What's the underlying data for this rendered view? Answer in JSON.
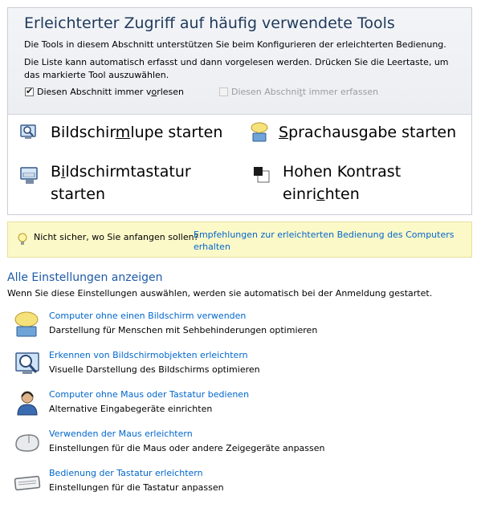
{
  "quick_access": {
    "title": "Erleichterter Zugriff auf häufig verwendete Tools",
    "description1": "Die Tools in diesem Abschnitt unterstützen Sie beim Konfigurieren der erleichterten Bedienung.",
    "description2": "Die Liste kann automatisch erfasst und dann vorgelesen werden. Drücken Sie die Leertaste, um das markierte Tool auszuwählen.",
    "checkbox_read": {
      "label_pre": "Diesen Abschnitt immer v",
      "label_u": "o",
      "label_post": "rlesen",
      "checked": true
    },
    "checkbox_scan": {
      "label_pre": "Diesen Abschni",
      "label_u": "t",
      "label_post": "t immer erfassen",
      "checked": false,
      "disabled": true
    },
    "tools": {
      "magnifier": {
        "pre": "Bildschir",
        "u": "m",
        "post": "lupe starten"
      },
      "narrator": {
        "pre": "",
        "u": "S",
        "post": "prachausgabe starten"
      },
      "osk": {
        "pre": "B",
        "u": "i",
        "post": "ldschirmtastatur starten"
      },
      "contrast": {
        "pre": "Hohen Kontrast einri",
        "u": "c",
        "post": "hten"
      }
    }
  },
  "tip": {
    "text": "Nicht sicher, wo Sie anfangen sollen?",
    "link": "Empfehlungen zur erleichterten Bedienung des Computers erhalten"
  },
  "all_settings": {
    "title": "Alle Einstellungen anzeigen",
    "description": "Wenn Sie diese Einstellungen auswählen, werden sie automatisch bei der Anmeldung gestartet.",
    "items": [
      {
        "link": "Computer ohne einen Bildschirm verwenden",
        "desc": "Darstellung für Menschen mit Sehbehinderungen optimieren",
        "icon": "speech-bubble-monitor-icon"
      },
      {
        "link": "Erkennen von Bildschirmobjekten erleichtern",
        "desc": "Visuelle Darstellung des Bildschirms optimieren",
        "icon": "magnifier-monitor-icon"
      },
      {
        "link": "Computer ohne Maus oder Tastatur bedienen",
        "desc": "Alternative Eingabegeräte einrichten",
        "icon": "person-headset-icon"
      },
      {
        "link": "Verwenden der Maus erleichtern",
        "desc": "Einstellungen für die Maus oder andere Zeigegeräte anpassen",
        "icon": "mouse-icon"
      },
      {
        "link": "Bedienung der Tastatur erleichtern",
        "desc": "Einstellungen für die Tastatur anpassen",
        "icon": "keyboard-icon"
      }
    ]
  }
}
